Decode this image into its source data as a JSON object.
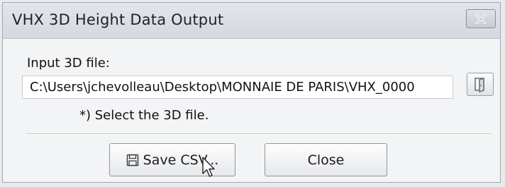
{
  "window": {
    "title": "VHX 3D Height Data Output",
    "close_icon": "close-x-icon"
  },
  "form": {
    "input_label": "Input 3D file:",
    "file_path": "C:\\Users\\jchevolleau\\Desktop\\MONNAIE DE PARIS\\VHX_0000",
    "browse_icon": "folder-open-icon",
    "hint": "*) Select the 3D file."
  },
  "buttons": {
    "save_csv": "Save CSV...",
    "save_icon": "floppy-disk-icon",
    "close": "Close"
  },
  "colors": {
    "titlebar": "#d4d9df",
    "window_bg": "#f3f4f5",
    "close_x": "#ffffff"
  }
}
